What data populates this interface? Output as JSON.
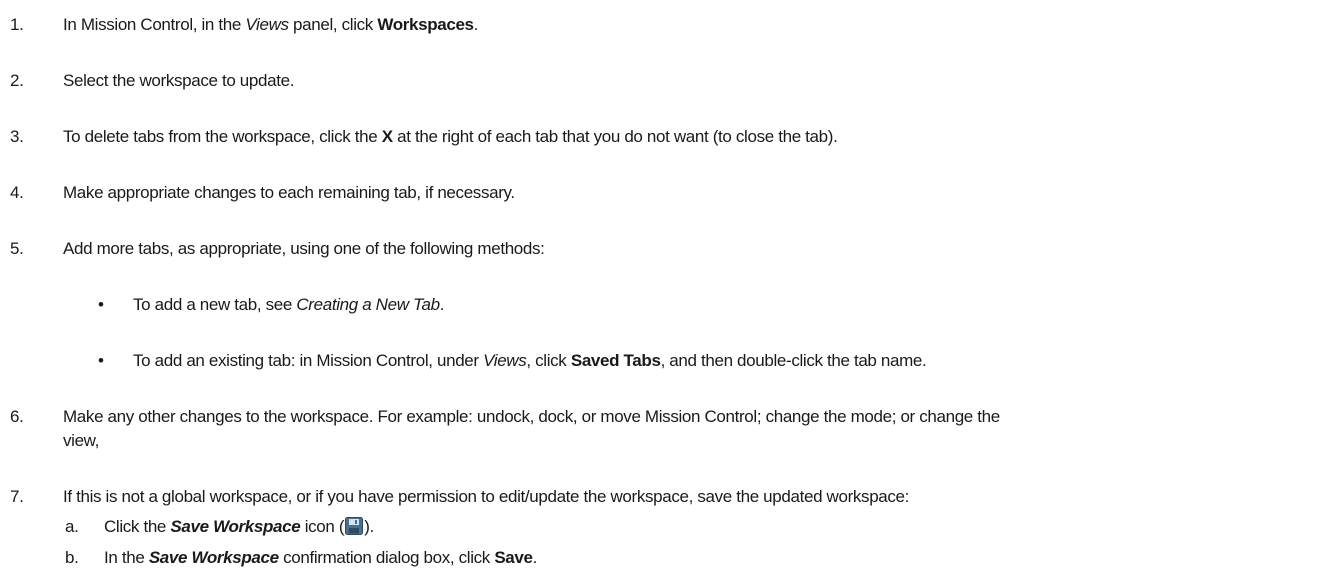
{
  "steps": [
    {
      "num": "1.",
      "parts": [
        {
          "t": "In Mission Control, in the "
        },
        {
          "t": "Views",
          "s": "i"
        },
        {
          "t": " panel, click "
        },
        {
          "t": "Workspaces",
          "s": "b"
        },
        {
          "t": "."
        }
      ]
    },
    {
      "num": "2.",
      "parts": [
        {
          "t": "Select the workspace to update."
        }
      ]
    },
    {
      "num": "3.",
      "parts": [
        {
          "t": "To delete tabs from the workspace, click the "
        },
        {
          "t": "X",
          "s": "b"
        },
        {
          "t": " at the right of each tab that you do not want (to close the tab)."
        }
      ]
    },
    {
      "num": "4.",
      "parts": [
        {
          "t": "Make appropriate changes to each remaining tab, if necessary."
        }
      ]
    },
    {
      "num": "5.",
      "parts": [
        {
          "t": "Add more tabs, as appropriate, using one of the following methods:"
        }
      ],
      "bullets": [
        {
          "symbol": "•",
          "parts": [
            {
              "t": "To add a new tab, see "
            },
            {
              "t": "Creating a New Tab",
              "s": "i"
            },
            {
              "t": "."
            }
          ]
        },
        {
          "symbol": "•",
          "parts": [
            {
              "t": "To add an existing tab: in Mission Control, under "
            },
            {
              "t": "Views",
              "s": "i"
            },
            {
              "t": ", click "
            },
            {
              "t": "Saved Tabs",
              "s": "b"
            },
            {
              "t": ", and then double-click the tab name."
            }
          ]
        }
      ]
    },
    {
      "num": "6.",
      "parts": [
        {
          "t": "Make any other changes to the workspace. For example: undock, dock, or move Mission Control; change the mode; or change the"
        }
      ],
      "cont": "view,"
    },
    {
      "num": "7.",
      "parts": [
        {
          "t": "If this is not a global workspace, or if you have permission to edit/update the workspace, save the updated workspace:"
        }
      ],
      "substeps": [
        {
          "letter": "a.",
          "before": [
            {
              "t": "Click the "
            },
            {
              "t": "Save Workspace",
              "s": "bi"
            },
            {
              "t": " icon ("
            }
          ],
          "icon": "save-workspace-icon",
          "after": [
            {
              "t": ")."
            }
          ]
        },
        {
          "letter": "b.",
          "before": [
            {
              "t": "In the "
            },
            {
              "t": "Save Workspace",
              "s": "bi"
            },
            {
              "t": " confirmation dialog box, click "
            },
            {
              "t": "Save",
              "s": "b"
            },
            {
              "t": "."
            }
          ]
        }
      ]
    }
  ],
  "colors": {
    "text": "#1a1a1a",
    "icon_body": "#4a6f8f",
    "icon_shutter": "#d9e2ea"
  }
}
